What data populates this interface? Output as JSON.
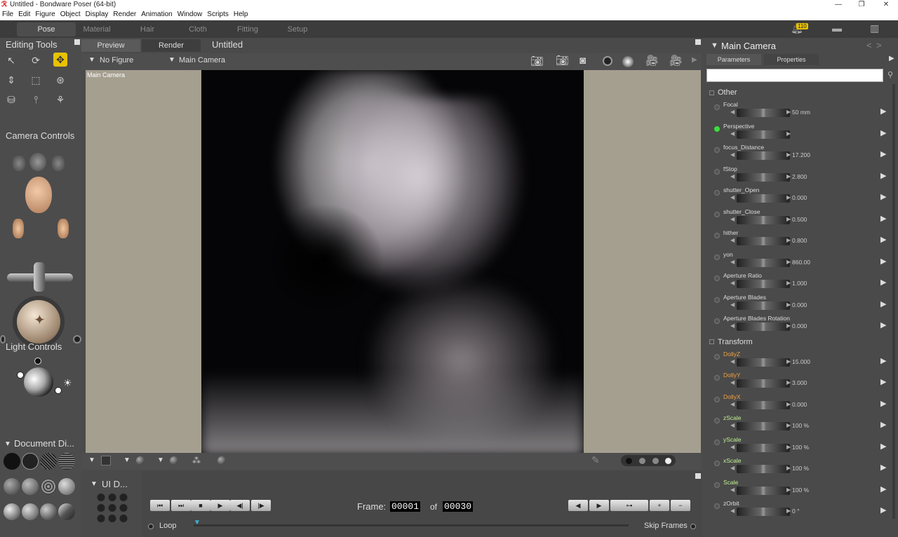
{
  "window": {
    "title": "Untitled - Bondware Poser (64-bit)",
    "min": "—",
    "max": "❐",
    "close": "✕"
  },
  "menu": [
    "File",
    "Edit",
    "Figure",
    "Object",
    "Display",
    "Render",
    "Animation",
    "Window",
    "Scripts",
    "Help"
  ],
  "rooms": [
    "Pose",
    "Material",
    "Hair",
    "Cloth",
    "Fitting",
    "Setup"
  ],
  "notify_count": "110",
  "left": {
    "editing_tools": "Editing Tools",
    "camera_controls": "Camera Controls",
    "light_controls": "Light Controls",
    "document_display": "Document Di...",
    "ui_dots": "UI D..."
  },
  "viewport": {
    "tab_preview": "Preview",
    "tab_render": "Render",
    "doc_title": "Untitled",
    "figure_select": "No Figure",
    "camera_select": "Main Camera",
    "label": "Main Camera"
  },
  "right": {
    "title": "Main Camera",
    "tab_parameters": "Parameters",
    "tab_properties": "Properties",
    "search_placeholder": "",
    "groups": [
      {
        "name": "Other",
        "params": [
          {
            "name": "Focal",
            "value": "50 mm",
            "color": "normal",
            "dot": false
          },
          {
            "name": "Perspective",
            "value": "",
            "color": "normal",
            "dot": true
          },
          {
            "name": "focus_Distance",
            "value": "17.200",
            "color": "normal",
            "dot": false
          },
          {
            "name": "fStop",
            "value": "2.800",
            "color": "normal",
            "dot": false
          },
          {
            "name": "shutter_Open",
            "value": "0.000",
            "color": "normal",
            "dot": false
          },
          {
            "name": "shutter_Close",
            "value": "0.500",
            "color": "normal",
            "dot": false
          },
          {
            "name": "hither",
            "value": "0.800",
            "color": "normal",
            "dot": false
          },
          {
            "name": "yon",
            "value": "860.00",
            "color": "normal",
            "dot": false
          },
          {
            "name": "Aperture Ratio",
            "value": "1.000",
            "color": "normal",
            "dot": false
          },
          {
            "name": "Aperture Blades",
            "value": "0.000",
            "color": "normal",
            "dot": false
          },
          {
            "name": "Aperture Blades Rotation",
            "value": "0.000",
            "color": "normal",
            "dot": false
          }
        ]
      },
      {
        "name": "Transform",
        "params": [
          {
            "name": "DollyZ",
            "value": "15.000",
            "color": "orange",
            "dot": false
          },
          {
            "name": "DollyY",
            "value": "3.000",
            "color": "orange",
            "dot": false
          },
          {
            "name": "DollyX",
            "value": "0.000",
            "color": "orange",
            "dot": false
          },
          {
            "name": "zScale",
            "value": "100 %",
            "color": "green",
            "dot": false
          },
          {
            "name": "yScale",
            "value": "100 %",
            "color": "green",
            "dot": false
          },
          {
            "name": "xScale",
            "value": "100 %",
            "color": "green",
            "dot": false
          },
          {
            "name": "Scale",
            "value": "100 %",
            "color": "green",
            "dot": false
          },
          {
            "name": "zOrbit",
            "value": "0 °",
            "color": "normal",
            "dot": false
          }
        ]
      }
    ]
  },
  "timeline": {
    "frame_label": "Frame:",
    "frame_current": "00001",
    "of_label": "of",
    "frame_total": "00030",
    "loop_label": "Loop",
    "skip_frames_label": "Skip Frames"
  }
}
